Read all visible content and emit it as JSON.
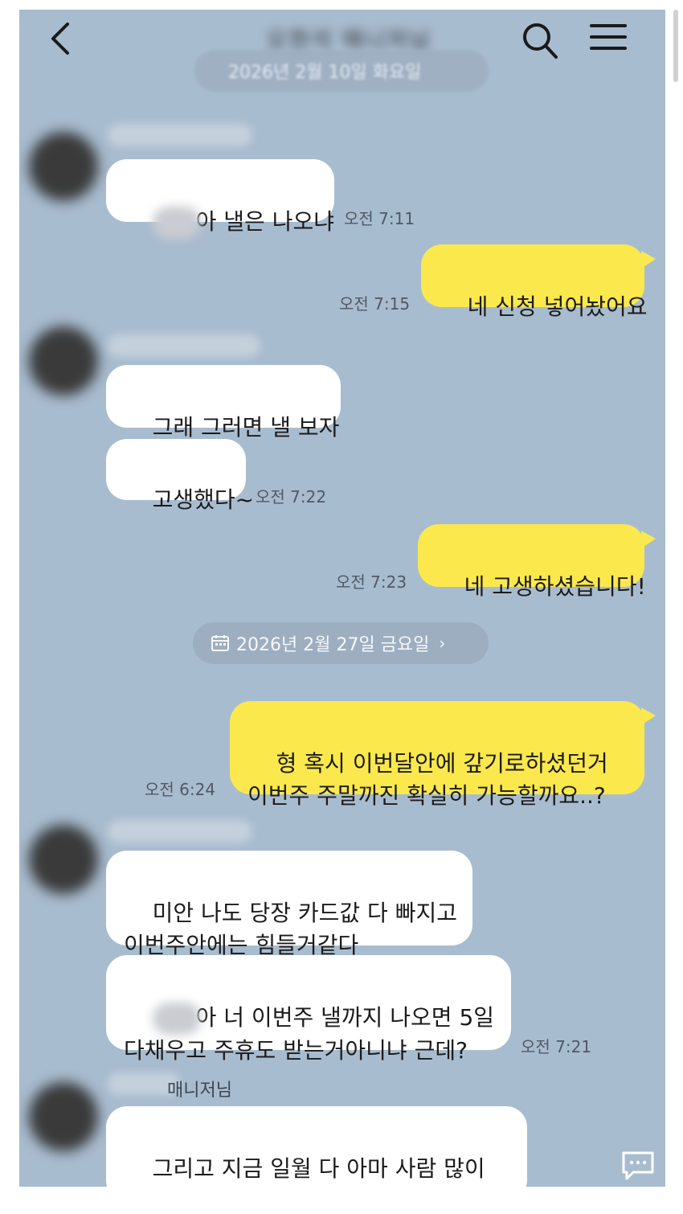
{
  "header": {
    "title": "오현석 매니저님",
    "back_icon": "chevron-left-icon",
    "search_icon": "search-icon",
    "menu_icon": "hamburger-menu-icon"
  },
  "date_top": "2026년 2월 10일 화요일",
  "date_divider": "2026년 2월 27일 금요일",
  "messages": [
    {
      "side": "in",
      "text": "아 낼은 나오냐",
      "time": "오전 7:11"
    },
    {
      "side": "out",
      "text": "네 신청 넣어놨어요",
      "time": "오전 7:15"
    },
    {
      "side": "in",
      "text": "그래 그러면 낼 보자",
      "time": ""
    },
    {
      "side": "in",
      "text": "고생했다~",
      "time": "오전 7:22"
    },
    {
      "side": "out",
      "text": "네 고생하셨습니다!",
      "time": "오전 7:23"
    },
    {
      "side": "out",
      "text": "형 혹시 이번달안에 갚기로하셨던거\n이번주 주말까진 확실히 가능할까요..?",
      "time": "오전 6:24"
    },
    {
      "side": "in",
      "text": "미안 나도 당장 카드값 다 빠지고\n이번주안에는 힘들거같다",
      "time": ""
    },
    {
      "side": "in",
      "text": "아 너 이번주 낼까지 나오면 5일\n다채우고 주휴도 받는거아니냐 근데?",
      "time": "오전 7:21"
    },
    {
      "side": "in",
      "text": "그리고 지금 일월 다 아마 사람 많이\n뽑을 예정이라 이틀 다 나가면 공휴일",
      "time": ""
    }
  ],
  "sender_fragment": "매니저님",
  "colors": {
    "background": "#a8bccf",
    "outgoing": "#fbe84d",
    "incoming": "#ffffff"
  },
  "floating_icon": "chat-bubble-icon"
}
